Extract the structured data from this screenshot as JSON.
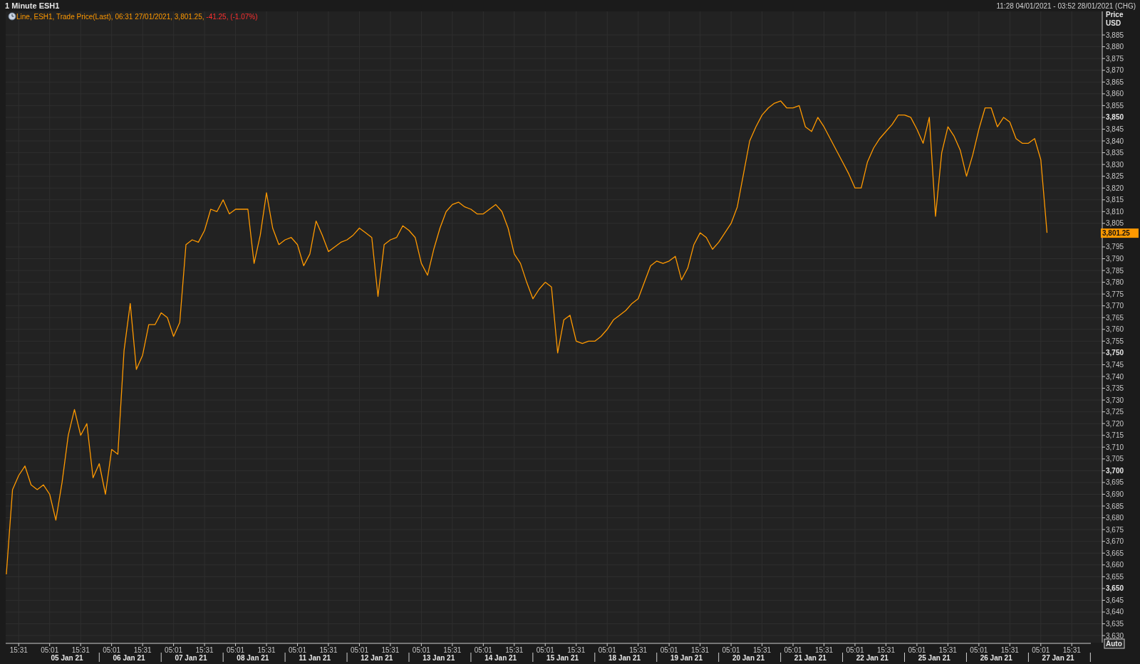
{
  "window": {
    "title": "1 Minute ESH1",
    "range": "11:28 04/01/2021 - 03:52 28/01/2021 (CHG)"
  },
  "chart": {
    "legend": {
      "text": "Line, ESH1, Trade Price(Last), 06:31 27/01/2021, 3,801.25, ",
      "change": "-41.25, (-1.07%)"
    },
    "axis_header": {
      "line_1": "Price",
      "line_2": "USD"
    },
    "last_price_label": "3,801.25",
    "auto_button": "Auto",
    "date_labels": [
      "05 Jan 21",
      "06 Jan 21",
      "07 Jan 21",
      "08 Jan 21",
      "11 Jan 21",
      "12 Jan 21",
      "13 Jan 21",
      "14 Jan 21",
      "15 Jan 21",
      "18 Jan 21",
      "19 Jan 21",
      "20 Jan 21",
      "21 Jan 21",
      "22 Jan 21",
      "25 Jan 21",
      "26 Jan 21",
      "27 Jan 21"
    ],
    "chart_data": {
      "type": "line",
      "categories": [
        null,
        null,
        "15:31",
        null,
        null,
        null,
        null,
        "05:01",
        null,
        null,
        null,
        null,
        "15:31",
        null,
        null,
        null,
        null,
        "05:01",
        null,
        null,
        null,
        null,
        "15:31",
        null,
        null,
        null,
        null,
        "05:01",
        null,
        null,
        null,
        null,
        "15:31",
        null,
        null,
        null,
        null,
        "05:01",
        null,
        null,
        null,
        null,
        "15:31",
        null,
        null,
        null,
        null,
        "05:01",
        null,
        null,
        null,
        null,
        "15:31",
        null,
        null,
        null,
        null,
        "05:01",
        null,
        null,
        null,
        null,
        "15:31",
        null,
        null,
        null,
        null,
        "05:01",
        null,
        null,
        null,
        null,
        "15:31",
        null,
        null,
        null,
        null,
        "05:01",
        null,
        null,
        null,
        null,
        "15:31",
        null,
        null,
        null,
        null,
        "05:01",
        null,
        null,
        null,
        null,
        "15:31",
        null,
        null,
        null,
        null,
        "05:01",
        null,
        null,
        null,
        null,
        "15:31",
        null,
        null,
        null,
        null,
        "05:01",
        null,
        null,
        null,
        null,
        "15:31",
        null,
        null,
        null,
        null,
        "05:01",
        null,
        null,
        null,
        null,
        "15:31",
        null,
        null,
        null,
        null,
        "05:01",
        null,
        null,
        null,
        null,
        "15:31",
        null,
        null,
        null,
        null,
        "05:01",
        null,
        null,
        null,
        null,
        "15:31",
        null,
        null,
        null,
        null,
        "05:01",
        null,
        null,
        null,
        null,
        "15:31",
        null,
        null,
        null,
        null,
        "05:01",
        null,
        null,
        null,
        null,
        "15:31",
        null,
        null,
        null,
        null,
        "05:01",
        null,
        null,
        null,
        null,
        "15:31",
        null,
        null,
        null,
        null
      ],
      "series": [
        {
          "color": "#ff9900",
          "values": [
            3656,
            3692,
            3698,
            3702,
            3694,
            3692,
            3694,
            3690,
            3679,
            3695,
            3715,
            3726,
            3715,
            3720,
            3697,
            3703,
            3690,
            3709,
            3707,
            3751,
            3771,
            3743,
            3749,
            3762,
            3762,
            3767,
            3765,
            3757,
            3763,
            3796,
            3798,
            3797,
            3802,
            3811,
            3810,
            3815,
            3809,
            3811,
            3811,
            3811,
            3788,
            3800,
            3818,
            3803,
            3796,
            3798,
            3799,
            3796,
            3787,
            3792,
            3806,
            3800,
            3793,
            3795,
            3797,
            3798,
            3800,
            3803,
            3801,
            3799,
            3774,
            3796,
            3798,
            3799,
            3804,
            3802,
            3799,
            3788,
            3783,
            3794,
            3803,
            3810,
            3813,
            3814,
            3812,
            3811,
            3809,
            3809,
            3811,
            3813,
            3810,
            3803,
            3792,
            3788,
            3780,
            3773,
            3777,
            3780,
            3778,
            3750,
            3764,
            3766,
            3755,
            3754,
            3755,
            3755,
            3757,
            3760,
            3764,
            3766,
            3768,
            3771,
            3773,
            3780,
            3787,
            3789,
            3788,
            3789,
            3791,
            3781,
            3786,
            3796,
            3801,
            3799,
            3794,
            3797,
            3801,
            3805,
            3812,
            3826,
            3840,
            3846,
            3851,
            3854,
            3856,
            3857,
            3854,
            3854,
            3855,
            3846,
            3844,
            3850,
            3846,
            3841,
            3836,
            3831,
            3826,
            3820,
            3820,
            3831,
            3837,
            3841,
            3844,
            3847,
            3851,
            3851,
            3850,
            3845,
            3839,
            3850,
            3808,
            3835,
            3846,
            3842,
            3836,
            3825,
            3834,
            3845,
            3854,
            3854,
            3846,
            3850,
            3848,
            3841,
            3839,
            3839,
            3841,
            3832,
            3801,
            null,
            null,
            null,
            null,
            null,
            null,
            null,
            null
          ]
        }
      ],
      "ylim": [
        3627,
        3895
      ],
      "grid": true,
      "yticks": [
        {
          "value": 3885,
          "label": "3,885"
        },
        {
          "value": 3880,
          "label": "3,880"
        },
        {
          "value": 3875,
          "label": "3,875"
        },
        {
          "value": 3870,
          "label": "3,870"
        },
        {
          "value": 3865,
          "label": "3,865"
        },
        {
          "value": 3860,
          "label": "3,860"
        },
        {
          "value": 3855,
          "label": "3,855"
        },
        {
          "value": 3850,
          "label": "3,850"
        },
        {
          "value": 3845,
          "label": "3,845"
        },
        {
          "value": 3840,
          "label": "3,840"
        },
        {
          "value": 3835,
          "label": "3,835"
        },
        {
          "value": 3830,
          "label": "3,830"
        },
        {
          "value": 3825,
          "label": "3,825"
        },
        {
          "value": 3820,
          "label": "3,820"
        },
        {
          "value": 3815,
          "label": "3,815"
        },
        {
          "value": 3810,
          "label": "3,810"
        },
        {
          "value": 3805,
          "label": "3,805"
        },
        {
          "value": 3795,
          "label": "3,795"
        },
        {
          "value": 3790,
          "label": "3,790"
        },
        {
          "value": 3785,
          "label": "3,785"
        },
        {
          "value": 3780,
          "label": "3,780"
        },
        {
          "value": 3775,
          "label": "3,775"
        },
        {
          "value": 3770,
          "label": "3,770"
        },
        {
          "value": 3765,
          "label": "3,765"
        },
        {
          "value": 3760,
          "label": "3,760"
        },
        {
          "value": 3755,
          "label": "3,755"
        },
        {
          "value": 3750,
          "label": "3,750"
        },
        {
          "value": 3745,
          "label": "3,745"
        },
        {
          "value": 3740,
          "label": "3,740"
        },
        {
          "value": 3735,
          "label": "3,735"
        },
        {
          "value": 3730,
          "label": "3,730"
        },
        {
          "value": 3725,
          "label": "3,725"
        },
        {
          "value": 3720,
          "label": "3,720"
        },
        {
          "value": 3715,
          "label": "3,715"
        },
        {
          "value": 3710,
          "label": "3,710"
        },
        {
          "value": 3705,
          "label": "3,705"
        },
        {
          "value": 3700,
          "label": "3,700"
        },
        {
          "value": 3695,
          "label": "3,695"
        },
        {
          "value": 3690,
          "label": "3,690"
        },
        {
          "value": 3685,
          "label": "3,685"
        },
        {
          "value": 3680,
          "label": "3,680"
        },
        {
          "value": 3675,
          "label": "3,675"
        },
        {
          "value": 3670,
          "label": "3,670"
        },
        {
          "value": 3665,
          "label": "3,665"
        },
        {
          "value": 3660,
          "label": "3,660"
        },
        {
          "value": 3655,
          "label": "3,655"
        },
        {
          "value": 3650,
          "label": "3,650"
        },
        {
          "value": 3645,
          "label": "3,645"
        },
        {
          "value": 3640,
          "label": "3,640"
        },
        {
          "value": 3635,
          "label": "3,635"
        },
        {
          "value": 3630,
          "label": "3,630"
        }
      ]
    }
  }
}
